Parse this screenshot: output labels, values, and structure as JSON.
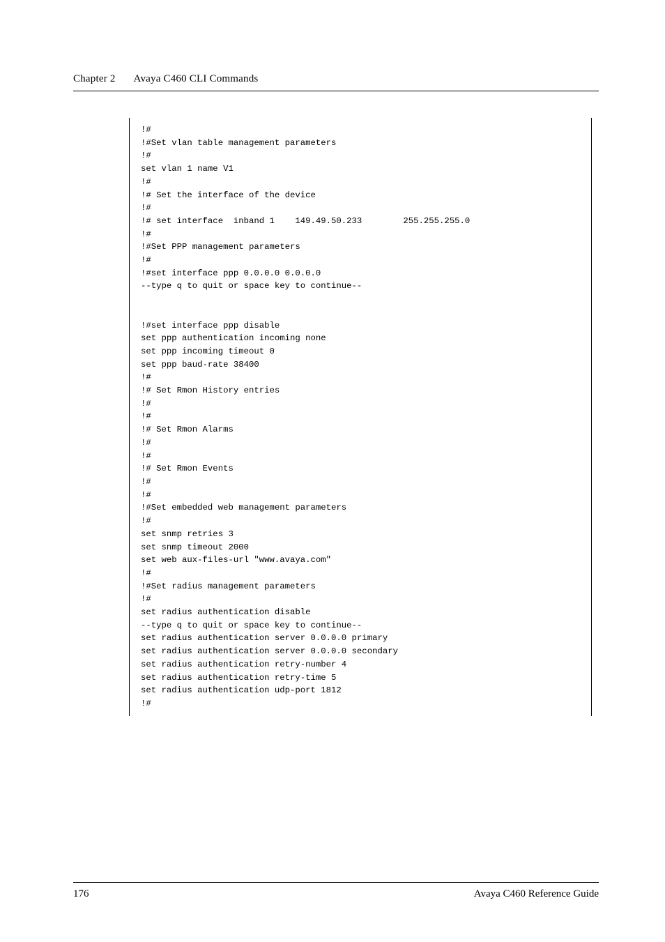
{
  "header": {
    "chapter_label": "Chapter 2",
    "chapter_title": "Avaya C460 CLI Commands"
  },
  "code": "!#\n!#Set vlan table management parameters\n!#\nset vlan 1 name V1\n!#\n!# Set the interface of the device\n!#\n!# set interface  inband 1    149.49.50.233        255.255.255.0\n!#\n!#Set PPP management parameters\n!#\n!#set interface ppp 0.0.0.0 0.0.0.0\n--type q to quit or space key to continue--\n\n\n!#set interface ppp disable\nset ppp authentication incoming none\nset ppp incoming timeout 0\nset ppp baud-rate 38400\n!#\n!# Set Rmon History entries\n!#\n!#\n!# Set Rmon Alarms\n!#\n!#\n!# Set Rmon Events\n!#\n!#\n!#Set embedded web management parameters\n!#\nset snmp retries 3\nset snmp timeout 2000\nset web aux-files-url \"www.avaya.com\"\n!#\n!#Set radius management parameters\n!#\nset radius authentication disable\n--type q to quit or space key to continue--\nset radius authentication server 0.0.0.0 primary\nset radius authentication server 0.0.0.0 secondary\nset radius authentication retry-number 4\nset radius authentication retry-time 5\nset radius authentication udp-port 1812\n!#",
  "footer": {
    "page_number": "176",
    "book_title": "Avaya C460 Reference Guide"
  }
}
